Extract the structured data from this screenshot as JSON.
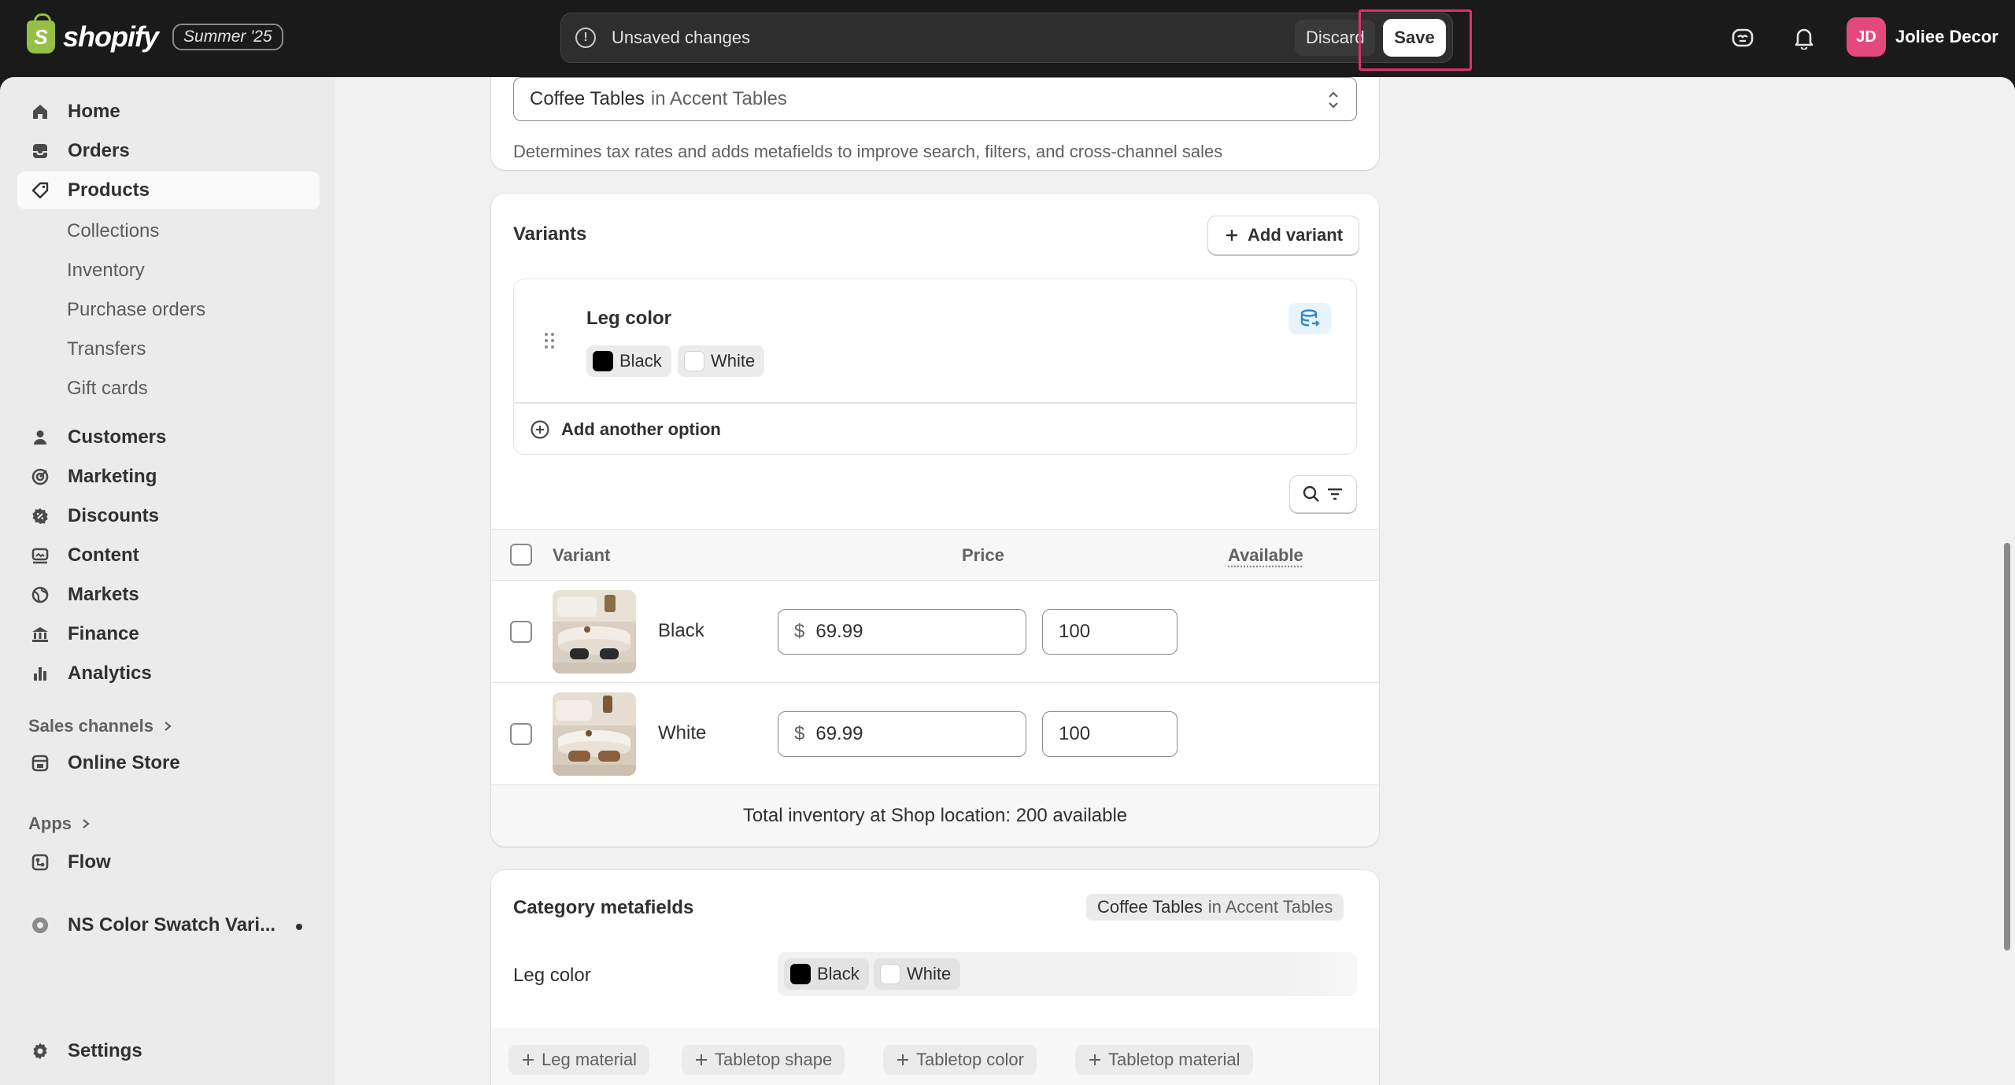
{
  "topbar": {
    "brand": "shopify",
    "logo_letter": "S",
    "edition": "Summer '25",
    "unsaved_text": "Unsaved changes",
    "discard_label": "Discard",
    "save_label": "Save",
    "user_initials": "JD",
    "user_name": "Joliee Decor"
  },
  "sidebar": {
    "items": [
      {
        "label": "Home",
        "icon": "home-icon"
      },
      {
        "label": "Orders",
        "icon": "inbox-icon"
      },
      {
        "label": "Products",
        "icon": "tag-icon"
      },
      {
        "label": "Customers",
        "icon": "person-icon"
      },
      {
        "label": "Marketing",
        "icon": "target-icon"
      },
      {
        "label": "Discounts",
        "icon": "discount-icon"
      },
      {
        "label": "Content",
        "icon": "content-icon"
      },
      {
        "label": "Markets",
        "icon": "globe-icon"
      },
      {
        "label": "Finance",
        "icon": "bank-icon"
      },
      {
        "label": "Analytics",
        "icon": "bar-chart-icon"
      }
    ],
    "product_subitems": [
      "Collections",
      "Inventory",
      "Purchase orders",
      "Transfers",
      "Gift cards"
    ],
    "sales_channels_label": "Sales channels",
    "online_store_label": "Online Store",
    "apps_label": "Apps",
    "flow_label": "Flow",
    "app_item_label": "NS Color Swatch Vari...",
    "settings_label": "Settings"
  },
  "category": {
    "value_main": "Coffee Tables",
    "value_suffix": "in Accent Tables",
    "helper": "Determines tax rates and adds metafields to improve search, filters, and cross-channel sales"
  },
  "variants": {
    "title": "Variants",
    "add_variant_label": "Add variant",
    "option": {
      "name": "Leg color",
      "values": [
        {
          "label": "Black",
          "color": "#000000"
        },
        {
          "label": "White",
          "color": "#ffffff"
        }
      ]
    },
    "add_option_label": "Add another option",
    "columns": {
      "variant": "Variant",
      "price": "Price",
      "available": "Available"
    },
    "rows": [
      {
        "name": "Black",
        "currency": "$",
        "price": "69.99",
        "available": "100"
      },
      {
        "name": "White",
        "currency": "$",
        "price": "69.99",
        "available": "100"
      }
    ],
    "total": "Total inventory at Shop location: 200 available"
  },
  "metafields": {
    "title": "Category metafields",
    "badge_main": "Coffee Tables",
    "badge_suffix": "in Accent Tables",
    "row_label": "Leg color",
    "values": [
      "Black",
      "White"
    ],
    "add_chips": [
      "Leg material",
      "Tabletop shape",
      "Tabletop color",
      "Tabletop material"
    ]
  },
  "colors": {
    "accent_highlight": "#d6336c",
    "avatar": "#e5487c",
    "logo_green": "#95bf47"
  }
}
